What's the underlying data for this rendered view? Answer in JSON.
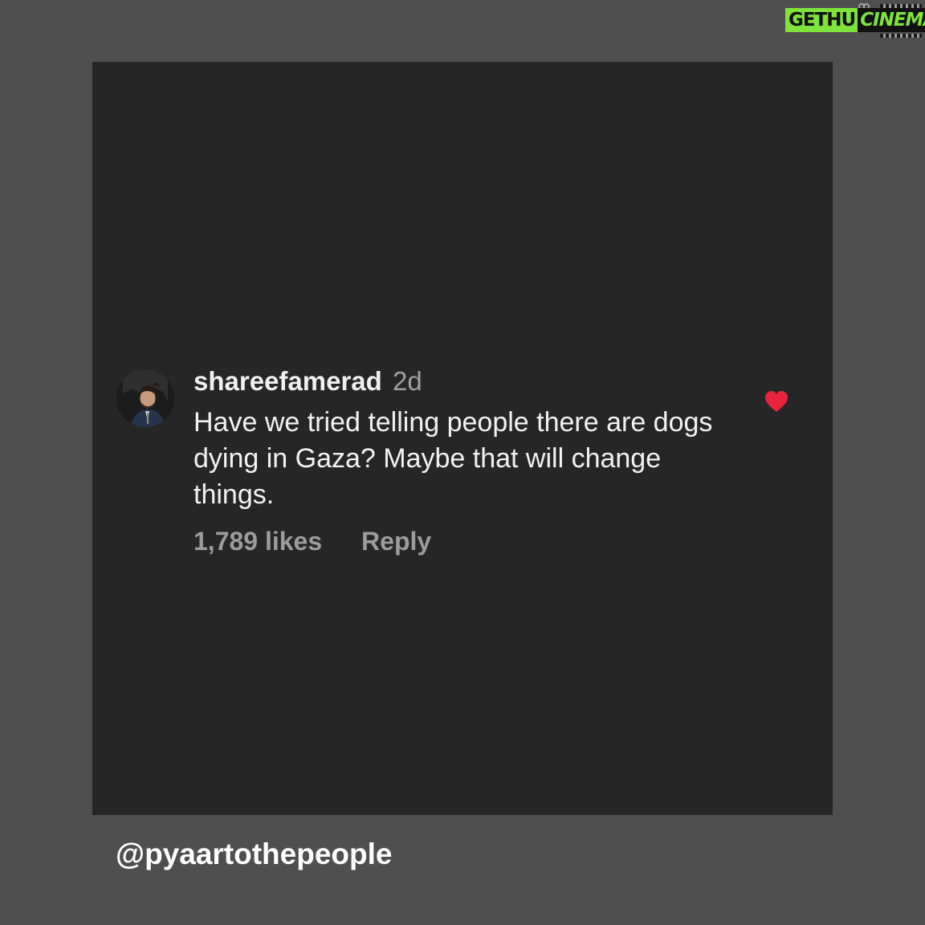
{
  "watermark": {
    "part1": "GETHU",
    "part2": "CINEMA",
    "colors": {
      "accent": "#7ee33a",
      "dark": "#111111"
    }
  },
  "comment": {
    "username": "shareefamerad",
    "timestamp": "2d",
    "text": "Have we tried telling people there are dogs dying in Gaza? Maybe that will change things.",
    "likes": "1,789 likes",
    "reply_label": "Reply",
    "liked": true,
    "heart_color": "#e8243c",
    "avatar": "user-avatar-photo"
  },
  "footer": {
    "handle": "@pyaartothepeople"
  },
  "colors": {
    "page_bg": "#4f4f4f",
    "card_bg": "#262626",
    "text_primary": "#f2f2f2",
    "text_secondary": "#9c9c9c"
  }
}
